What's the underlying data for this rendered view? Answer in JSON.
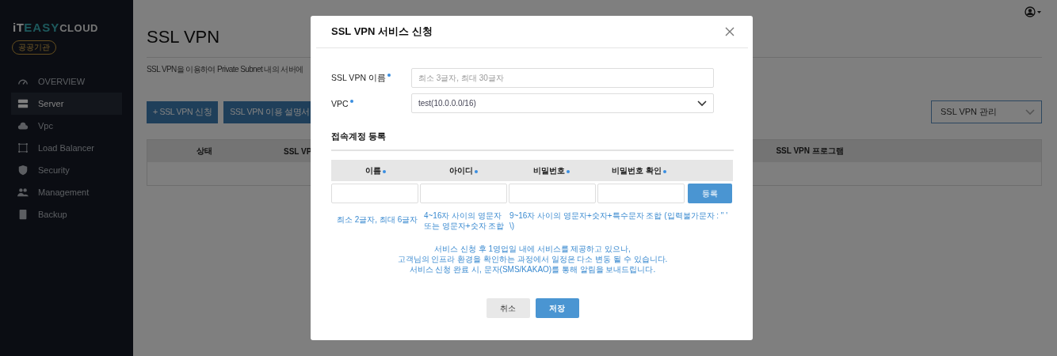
{
  "sidebar": {
    "logo": {
      "part_1": "iT",
      "part_2": "EASY",
      "part_3": "CLOUD"
    },
    "badge": "공공기관",
    "items": [
      {
        "label": "OVERVIEW",
        "selected": false
      },
      {
        "label": "Server",
        "selected": true
      },
      {
        "label": "Vpc",
        "selected": false
      },
      {
        "label": "Load Balancer",
        "selected": false
      },
      {
        "label": "Security",
        "selected": false
      },
      {
        "label": "Management",
        "selected": false
      },
      {
        "label": "Backup",
        "selected": false
      }
    ]
  },
  "page": {
    "title": "SSL VPN",
    "description": "SSL VPN을 이용하여 Private Subnet 내의 서버에",
    "buttons": [
      "+ SSL VPN 신청",
      "SSL VPN 이용 설명서"
    ],
    "manage_select": {
      "value": "SSL VPN 관리"
    },
    "table": {
      "columns": [
        "상태",
        "SSL VP",
        "SSL VPN 프로그램"
      ]
    }
  },
  "modal": {
    "title": "SSL VPN 서비스 신청",
    "fields": [
      {
        "kind": "text",
        "label": "SSL VPN 이름",
        "required": true,
        "placeholder": "최소 3글자, 최대 30글자"
      },
      {
        "kind": "select",
        "label": "VPC",
        "required": true,
        "value": "test(10.0.0.0/16)"
      }
    ],
    "section_title": "접속계정 등록",
    "account_table": {
      "columns": [
        {
          "label": "이름",
          "required": true
        },
        {
          "label": "아이디",
          "required": true
        },
        {
          "label": "비밀번호",
          "required": true
        },
        {
          "label": "비밀번호 확인",
          "required": true
        }
      ],
      "add_button": "등록",
      "hints": [
        "최소 2글자, 최대 6글자",
        "4~16자 사이의 영문자 또는 영문자+숫자 조합",
        "9~16자 사이의 영문자+숫자+특수문자 조합 (입력불가문자 : \" ' \\)"
      ]
    },
    "notice": [
      "서비스 신청 후 1영업일 내에 서비스를 제공하고 있으나,",
      "고객님의 인프라 환경을 확인하는 과정에서 일정은 다소 변동 될 수 있습니다.",
      "서비스 신청 완료 시, 문자(SMS/KAKAO)를 통해 알림을 보내드립니다."
    ],
    "buttons": [
      {
        "kind": "secondary",
        "label": "취소"
      },
      {
        "kind": "primary",
        "label": "저장"
      }
    ]
  }
}
